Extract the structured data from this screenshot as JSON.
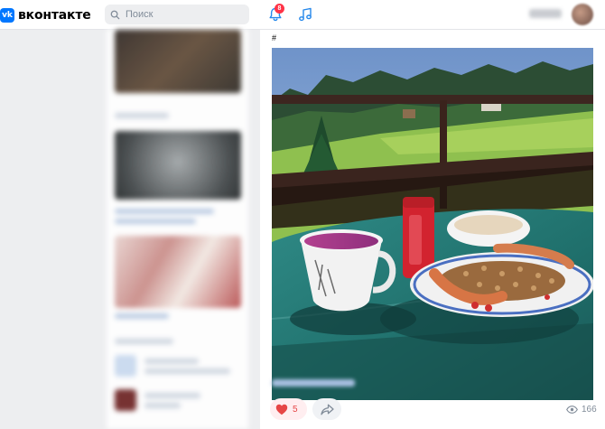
{
  "header": {
    "logo_text": "вконтакте",
    "logo_mark": "vk",
    "search_placeholder": "Поиск",
    "notifications_count": "8",
    "icons": [
      "vk-logo-icon",
      "search-icon",
      "bell-icon",
      "music-icon"
    ]
  },
  "post": {
    "hashtag": "#",
    "likes": "5",
    "views": "166",
    "icons": [
      "heart-icon",
      "share-icon",
      "eye-icon"
    ]
  },
  "colors": {
    "accent": "#0077ff",
    "like": "#e64646",
    "badge": "#ff3347",
    "background": "#edeef0"
  }
}
